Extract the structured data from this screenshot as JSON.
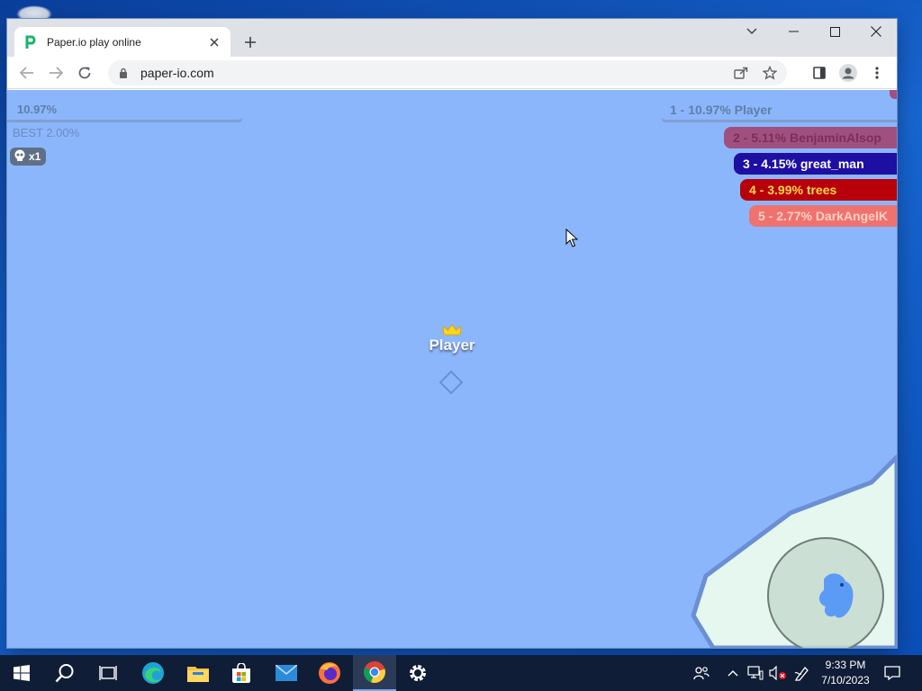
{
  "browser": {
    "tab_title": "Paper.io play online",
    "url": "paper-io.com"
  },
  "game": {
    "hud": {
      "percent": "10.97%",
      "best": "BEST 2.00%",
      "kills": "x1"
    },
    "leaderboard": [
      {
        "text": "1 - 10.97% Player",
        "color": "#7d9fd0"
      },
      {
        "text": "2 - 5.11% BenjaminAlsop",
        "color": "#a0507f"
      },
      {
        "text": "3 - 4.15% great_man",
        "color": "#1e0fa3"
      },
      {
        "text": "4 - 3.99% trees",
        "color": "#b8000a"
      },
      {
        "text": "5 - 2.77% DarkAngelK",
        "color": "#f0726e"
      }
    ],
    "player_name": "Player",
    "colors": {
      "field": "#8cb6fb",
      "territory": "#e6f7ef",
      "trail": "#6a8fd4",
      "minimap_player": "#5b9bf6"
    }
  },
  "taskbar": {
    "apps": [
      "start-icon",
      "search-icon",
      "task-view-icon",
      "edge-icon",
      "file-explorer-icon",
      "store-icon",
      "mail-icon",
      "firefox-icon",
      "chrome-icon",
      "settings-icon"
    ],
    "time": "9:33 PM",
    "date": "7/10/2023"
  }
}
